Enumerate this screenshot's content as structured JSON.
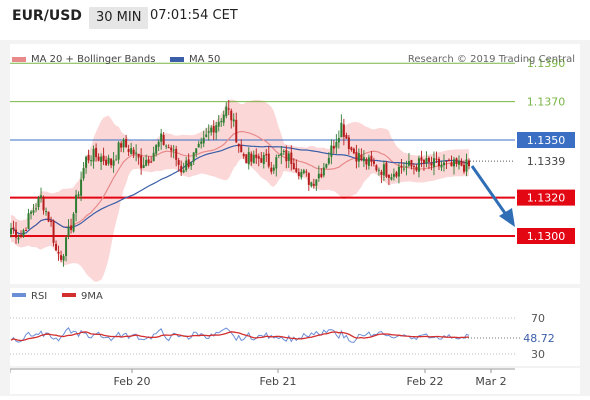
{
  "header": {
    "symbol": "EUR/USD",
    "timeframe": "30 MIN",
    "time": "07:01:54 CET"
  },
  "legend": {
    "ma20_bb": "MA 20 + Bollinger Bands",
    "ma50": "MA 50",
    "credit": "Research © 2019 Trading Central"
  },
  "rsi_legend": {
    "rsi": "RSI",
    "ma9": "9MA"
  },
  "colors": {
    "bb_fill": "#fbd3d3",
    "ma20": "#e88a8a",
    "ma50": "#3a5ea8",
    "up": "#2e7d32",
    "down": "#b71c1c",
    "target_green": "#7ab646",
    "pivot_blue": "#3a6fc4",
    "support_red": "#e30613",
    "rsi_line": "#6b8fd6",
    "rsi_ma": "#d32f2f",
    "arrow": "#2f6eb5"
  },
  "chart_data": {
    "type": "candlestick",
    "y_range": [
      1.1275,
      1.14
    ],
    "levels": [
      {
        "value": 1.139,
        "label": "1.1390",
        "kind": "target",
        "color": "#7ab646"
      },
      {
        "value": 1.137,
        "label": "1.1370",
        "kind": "target",
        "color": "#7ab646"
      },
      {
        "value": 1.135,
        "label": "1.1350",
        "kind": "pivot",
        "color": "#3a6fc4"
      },
      {
        "value": 1.1339,
        "label": "1.1339",
        "kind": "last",
        "color": "#555555"
      },
      {
        "value": 1.132,
        "label": "1.1320",
        "kind": "support",
        "color": "#e30613"
      },
      {
        "value": 1.13,
        "label": "1.1300",
        "kind": "support",
        "color": "#e30613"
      }
    ],
    "x_labels": [
      "Feb 20",
      "Feb 21",
      "Feb 22",
      "Mar 2"
    ],
    "rsi": {
      "last": "48.72",
      "levels": [
        "70",
        "30"
      ],
      "range": [
        20,
        80
      ]
    },
    "close_keypoints": [
      [
        0,
        1.1304
      ],
      [
        4,
        1.13
      ],
      [
        8,
        1.1312
      ],
      [
        12,
        1.132
      ],
      [
        16,
        1.1306
      ],
      [
        18,
        1.1292
      ],
      [
        20,
        1.129
      ],
      [
        22,
        1.1296
      ],
      [
        24,
        1.1306
      ],
      [
        28,
        1.133
      ],
      [
        30,
        1.134
      ],
      [
        32,
        1.1342
      ],
      [
        36,
        1.1341
      ],
      [
        40,
        1.1338
      ],
      [
        44,
        1.1348
      ],
      [
        48,
        1.1345
      ],
      [
        52,
        1.1338
      ],
      [
        56,
        1.1342
      ],
      [
        60,
        1.135
      ],
      [
        64,
        1.1345
      ],
      [
        68,
        1.1335
      ],
      [
        72,
        1.134
      ],
      [
        76,
        1.1346
      ],
      [
        80,
        1.1356
      ],
      [
        84,
        1.1362
      ],
      [
        86,
        1.1366
      ],
      [
        88,
        1.1362
      ],
      [
        92,
        1.1343
      ],
      [
        96,
        1.1339
      ],
      [
        100,
        1.1341
      ],
      [
        104,
        1.1337
      ],
      [
        108,
        1.1342
      ],
      [
        112,
        1.134
      ],
      [
        116,
        1.1333
      ],
      [
        120,
        1.1328
      ],
      [
        124,
        1.1334
      ],
      [
        128,
        1.1345
      ],
      [
        132,
        1.1358
      ],
      [
        136,
        1.1345
      ],
      [
        140,
        1.134
      ],
      [
        144,
        1.1337
      ],
      [
        148,
        1.1335
      ],
      [
        152,
        1.1333
      ],
      [
        156,
        1.1336
      ],
      [
        160,
        1.1336
      ],
      [
        164,
        1.1338
      ],
      [
        168,
        1.1337
      ],
      [
        172,
        1.1337
      ],
      [
        176,
        1.1336
      ],
      [
        180,
        1.1337
      ],
      [
        183,
        1.1336
      ]
    ]
  }
}
